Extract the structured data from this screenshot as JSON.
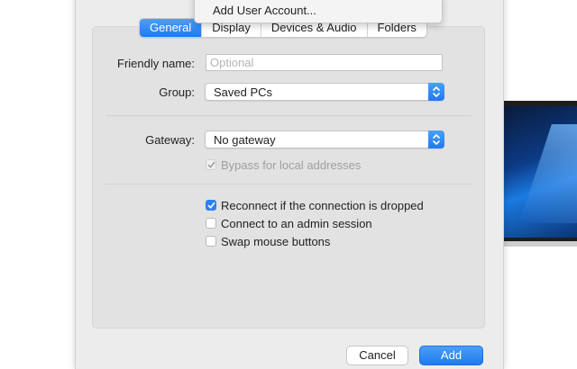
{
  "menu": {
    "items": [
      "Add User Account..."
    ]
  },
  "tabs": [
    {
      "label": "General",
      "active": true
    },
    {
      "label": "Display",
      "active": false
    },
    {
      "label": "Devices & Audio",
      "active": false
    },
    {
      "label": "Folders",
      "active": false
    }
  ],
  "form": {
    "friendly_name": {
      "label": "Friendly name:",
      "value": "",
      "placeholder": "Optional"
    },
    "group": {
      "label": "Group:",
      "value": "Saved PCs"
    },
    "gateway": {
      "label": "Gateway:",
      "value": "No gateway"
    },
    "bypass": {
      "label": "Bypass for local addresses",
      "checked": true,
      "enabled": false
    },
    "reconnect": {
      "label": "Reconnect if the connection is dropped",
      "checked": true
    },
    "admin_session": {
      "label": "Connect to an admin session",
      "checked": false
    },
    "swap_mouse": {
      "label": "Swap mouse buttons",
      "checked": false
    }
  },
  "buttons": {
    "cancel": "Cancel",
    "add": "Add"
  },
  "colors": {
    "accent": "#1f79f0",
    "panel": "#e2e2e2",
    "window": "#ececec"
  }
}
